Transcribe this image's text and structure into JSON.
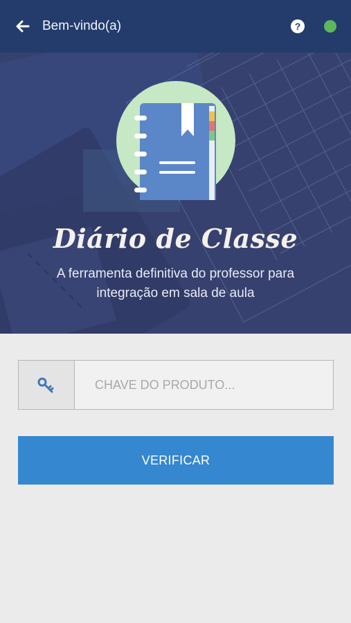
{
  "topbar": {
    "title": "Bem-vindo(a)",
    "back_icon": "arrow-left-icon",
    "help_icon": "question-circle-icon",
    "help_glyph": "?",
    "status_color": "#5cb85c"
  },
  "hero": {
    "app_name": "Diário de Classe",
    "tagline_line1": "A ferramenta definitiva do professor para",
    "tagline_line2": "integração em sala de aula",
    "logo_icon": "notebook-icon"
  },
  "form": {
    "key_icon": "key-icon",
    "key_placeholder": "CHAVE DO PRODUTO...",
    "key_value": "",
    "verify_label": "VERIFICAR"
  },
  "colors": {
    "topbar": "#233c6c",
    "primary_button": "#3587cf",
    "background": "#ebebeb",
    "status_online": "#5cb85c"
  }
}
